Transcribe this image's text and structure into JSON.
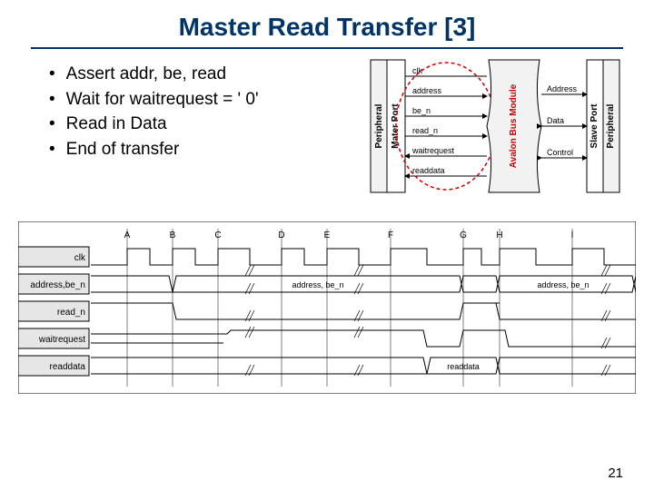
{
  "title": "Master Read Transfer [3]",
  "bullets": [
    "Assert addr, be, read",
    "Wait for waitrequest = ' 0'",
    "Read in Data",
    "End of transfer"
  ],
  "block_diagram": {
    "left_label": "Peripheral",
    "master_port": "Mater Port",
    "bus_module": "Avalon Bus Module",
    "slave_port": "Slave Port",
    "right_label": "Peripheral",
    "master_signals": [
      "clk",
      "address",
      "be_n",
      "read_n",
      "waitrequest",
      "readdata"
    ],
    "slave_signals": [
      "Address",
      "Data",
      "Control"
    ]
  },
  "timing": {
    "signals": [
      "clk",
      "address,be_n",
      "read_n",
      "waitrequest",
      "readdata"
    ],
    "markers": [
      "A",
      "B",
      "C",
      "D",
      "E",
      "F",
      "G",
      "H",
      "I"
    ],
    "bus_labels": {
      "addr1": "address, be_n",
      "addr2": "address, be_n",
      "readdata": "readdata"
    }
  },
  "page_number": "21"
}
